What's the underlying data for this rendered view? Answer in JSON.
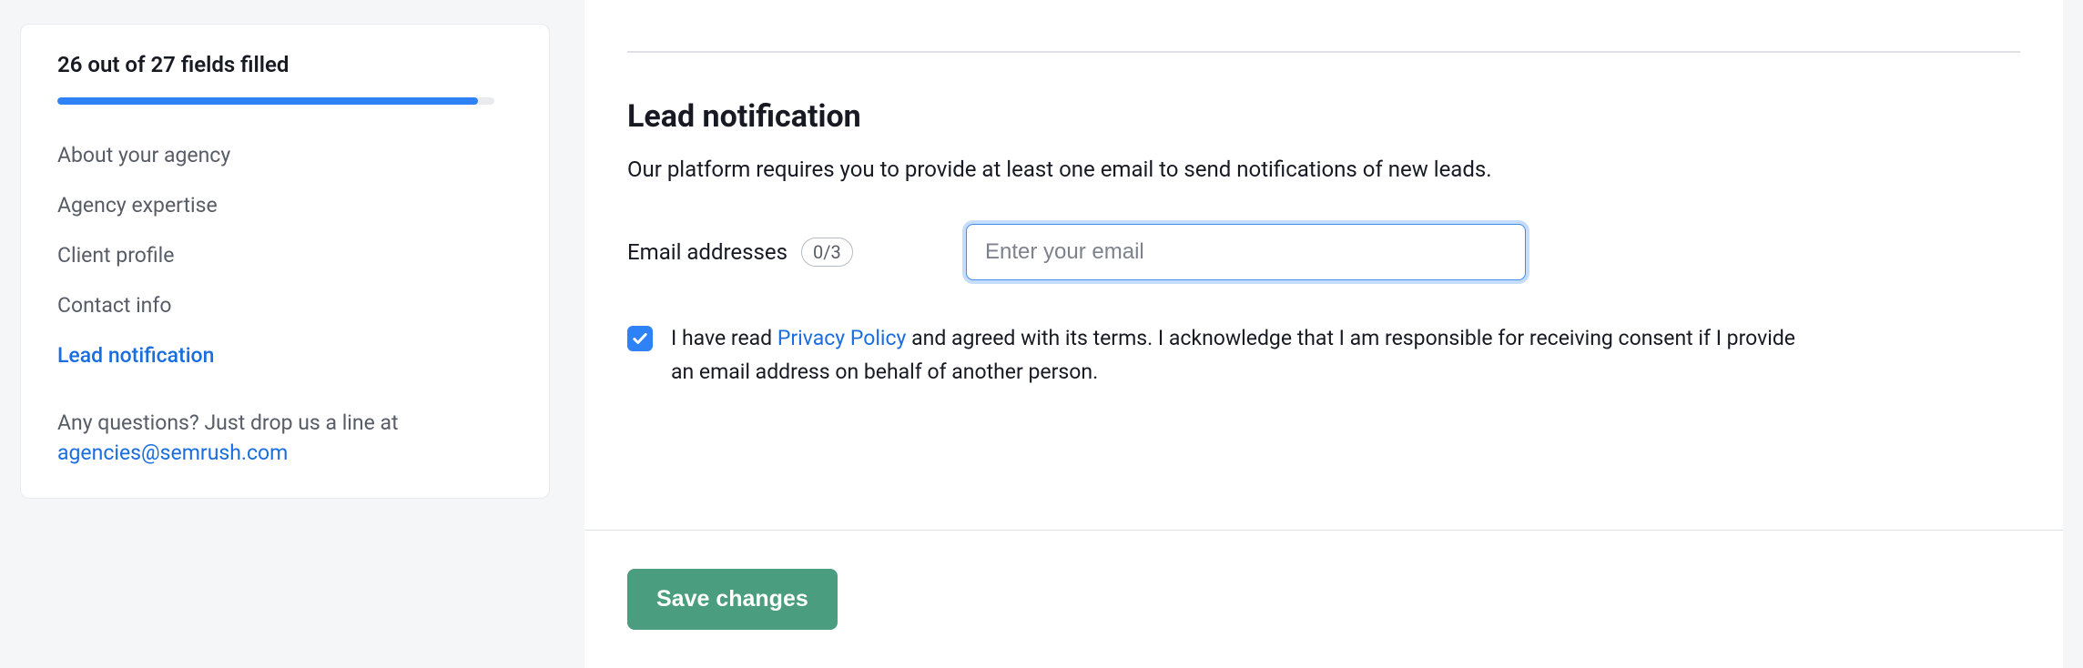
{
  "sidebar": {
    "progress_label": "26 out of 27 fields filled",
    "progress_percent": 96.3,
    "items": [
      {
        "label": "About your agency",
        "active": false
      },
      {
        "label": "Agency expertise",
        "active": false
      },
      {
        "label": "Client profile",
        "active": false
      },
      {
        "label": "Contact info",
        "active": false
      },
      {
        "label": "Lead notification",
        "active": true
      }
    ],
    "footer_prefix": "Any questions? Just drop us a line at ",
    "footer_email": "agencies@semrush.com"
  },
  "main": {
    "section_title": "Lead notification",
    "section_desc": "Our platform requires you to provide at least one email to send notifications of new leads.",
    "email_label": "Email addresses",
    "email_count_badge": "0/3",
    "email_placeholder": "Enter your email",
    "email_value": "",
    "consent_checked": true,
    "consent_text_before": "I have read ",
    "consent_link_text": "Privacy Policy",
    "consent_text_after": " and agreed with its terms. I acknowledge that I am responsible for receiving consent if I provide an email address on behalf of another person.",
    "save_label": "Save changes"
  },
  "colors": {
    "accent": "#2f81f6",
    "link": "#1a6dde",
    "save_btn": "#4a9d7f"
  }
}
